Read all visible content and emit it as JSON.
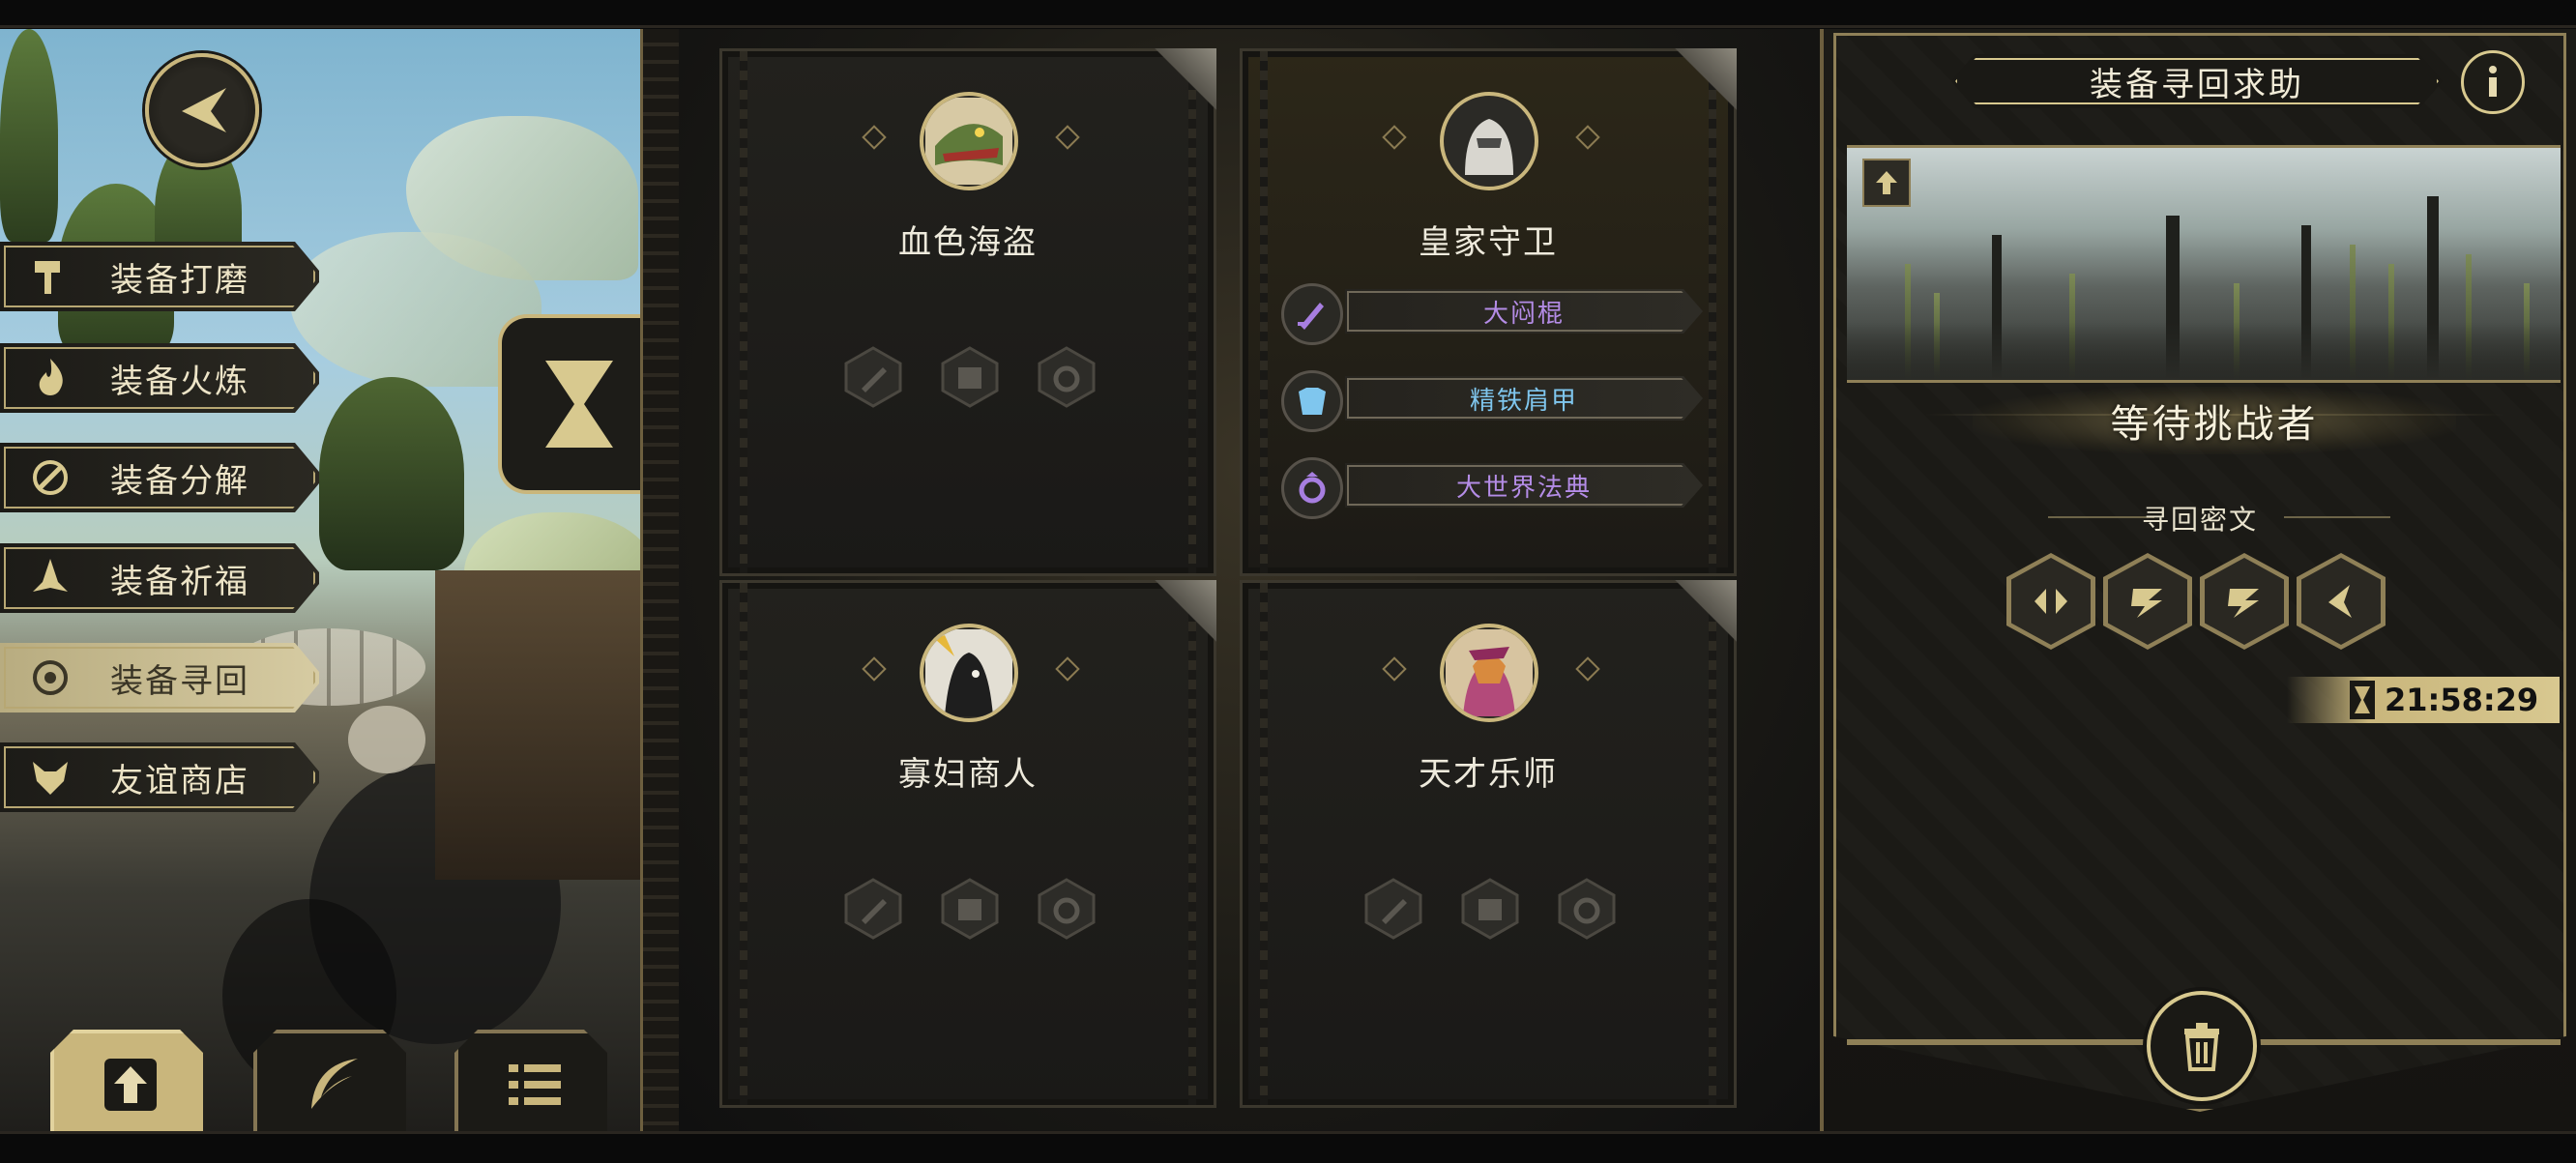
{
  "menu": {
    "items": [
      {
        "label": "装备打磨",
        "icon": "hammer-icon",
        "active": false
      },
      {
        "label": "装备火炼",
        "icon": "flame-icon",
        "active": false
      },
      {
        "label": "装备分解",
        "icon": "disassemble-icon",
        "active": false
      },
      {
        "label": "装备祈福",
        "icon": "pray-hands-icon",
        "active": false
      },
      {
        "label": "装备寻回",
        "icon": "retrieve-target-icon",
        "active": true
      },
      {
        "label": "友谊商店",
        "icon": "fox-mask-icon",
        "active": false
      }
    ]
  },
  "toolbar": {
    "buttons": [
      {
        "icon": "upload-icon",
        "active": true
      },
      {
        "icon": "feather-icon",
        "active": false
      },
      {
        "icon": "list-icon",
        "active": false
      }
    ]
  },
  "cards": [
    {
      "name": "血色海盗",
      "portrait": "crocodile-pirate",
      "equipment": []
    },
    {
      "name": "皇家守卫",
      "portrait": "white-knight",
      "equipment": [
        {
          "name": "大闷棍",
          "icon": "sword-icon",
          "color": "#b48ce6"
        },
        {
          "name": "精铁肩甲",
          "icon": "armor-icon",
          "color": "#7fc6ee"
        },
        {
          "name": "大世界法典",
          "icon": "ring-icon",
          "color": "#b48ce6"
        }
      ]
    },
    {
      "name": "寡妇商人",
      "portrait": "widow-merchant",
      "equipment": []
    },
    {
      "name": "天才乐师",
      "portrait": "fox-musician",
      "equipment": []
    }
  ],
  "right_panel": {
    "title": "装备寻回求助",
    "status": "等待挑战者",
    "cipher_label": "寻回密文",
    "ciphers": [
      "cipher-rune-1",
      "cipher-rune-2",
      "cipher-rune-3",
      "cipher-rune-4"
    ],
    "timer": "21:58:29"
  },
  "colors": {
    "gold": "#c9b67c",
    "purple": "#b48ce6",
    "blue": "#7fc6ee"
  }
}
